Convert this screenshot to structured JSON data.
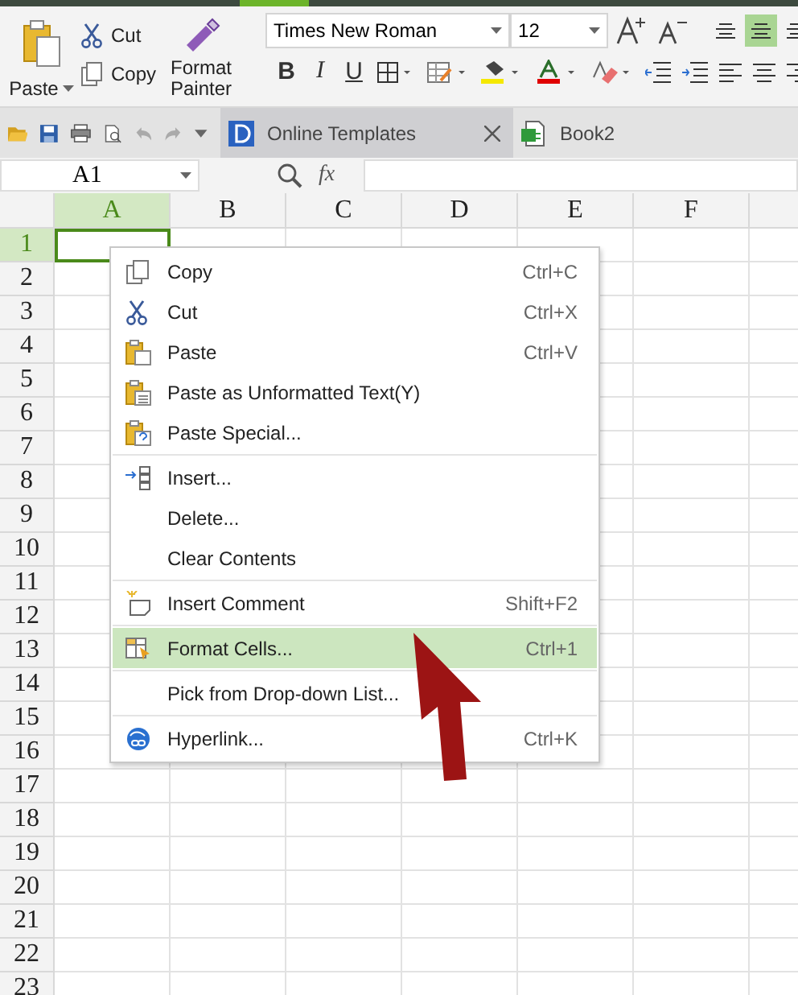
{
  "ribbon": {
    "paste": "Paste",
    "cut": "Cut",
    "copy": "Copy",
    "format_painter": "Format Painter",
    "font_name": "Times New Roman",
    "font_size": "12",
    "bold": "B",
    "italic": "I",
    "underline": "U",
    "alignments": [
      {
        "selected": false
      },
      {
        "selected": true
      },
      {
        "selected": false
      }
    ]
  },
  "tabs": [
    {
      "label": "Online Templates",
      "selected": true
    },
    {
      "label": "Book2",
      "selected": false
    }
  ],
  "name_box": "A1",
  "function_label": "fx",
  "columns": [
    {
      "label": "A",
      "selected": true
    },
    {
      "label": "B",
      "selected": false
    },
    {
      "label": "C",
      "selected": false
    },
    {
      "label": "D",
      "selected": false
    },
    {
      "label": "E",
      "selected": false
    },
    {
      "label": "F",
      "selected": false
    }
  ],
  "rows": [
    {
      "label": "1",
      "selected": true
    },
    {
      "label": "2",
      "selected": false
    },
    {
      "label": "3",
      "selected": false
    },
    {
      "label": "4",
      "selected": false
    },
    {
      "label": "5",
      "selected": false
    },
    {
      "label": "6",
      "selected": false
    },
    {
      "label": "7",
      "selected": false
    },
    {
      "label": "8",
      "selected": false
    },
    {
      "label": "9",
      "selected": false
    },
    {
      "label": "10",
      "selected": false
    },
    {
      "label": "11",
      "selected": false
    },
    {
      "label": "12",
      "selected": false
    },
    {
      "label": "13",
      "selected": false
    },
    {
      "label": "14",
      "selected": false
    },
    {
      "label": "15",
      "selected": false
    },
    {
      "label": "16",
      "selected": false
    },
    {
      "label": "17",
      "selected": false
    },
    {
      "label": "18",
      "selected": false
    },
    {
      "label": "19",
      "selected": false
    },
    {
      "label": "20",
      "selected": false
    },
    {
      "label": "21",
      "selected": false
    },
    {
      "label": "22",
      "selected": false
    },
    {
      "label": "23",
      "selected": false
    }
  ],
  "context_menu": [
    [
      {
        "label": "Copy",
        "shortcut": "Ctrl+C",
        "kind": "copy",
        "selected": false
      },
      {
        "label": "Cut",
        "shortcut": "Ctrl+X",
        "kind": "cut",
        "selected": false
      },
      {
        "label": "Paste",
        "shortcut": "Ctrl+V",
        "kind": "paste",
        "selected": false
      },
      {
        "label": "Paste as Unformatted Text(Y)",
        "kind": "pastetext",
        "selected": false
      },
      {
        "label": "Paste Special...",
        "kind": "pastespecial",
        "selected": false
      }
    ],
    [
      {
        "label": "Insert...",
        "kind": "insert",
        "selected": false
      },
      {
        "label": "Delete...",
        "selected": false
      },
      {
        "label": "Clear Contents",
        "selected": false
      }
    ],
    [
      {
        "label": "Insert Comment",
        "shortcut": "Shift+F2",
        "kind": "comment",
        "selected": false
      }
    ],
    [
      {
        "label": "Format Cells...",
        "shortcut": "Ctrl+1",
        "kind": "format",
        "selected": true
      }
    ],
    [
      {
        "label": "Pick from Drop-down List...",
        "selected": false
      }
    ],
    [
      {
        "label": "Hyperlink...",
        "shortcut": "Ctrl+K",
        "kind": "hyperlink",
        "selected": false
      }
    ]
  ]
}
